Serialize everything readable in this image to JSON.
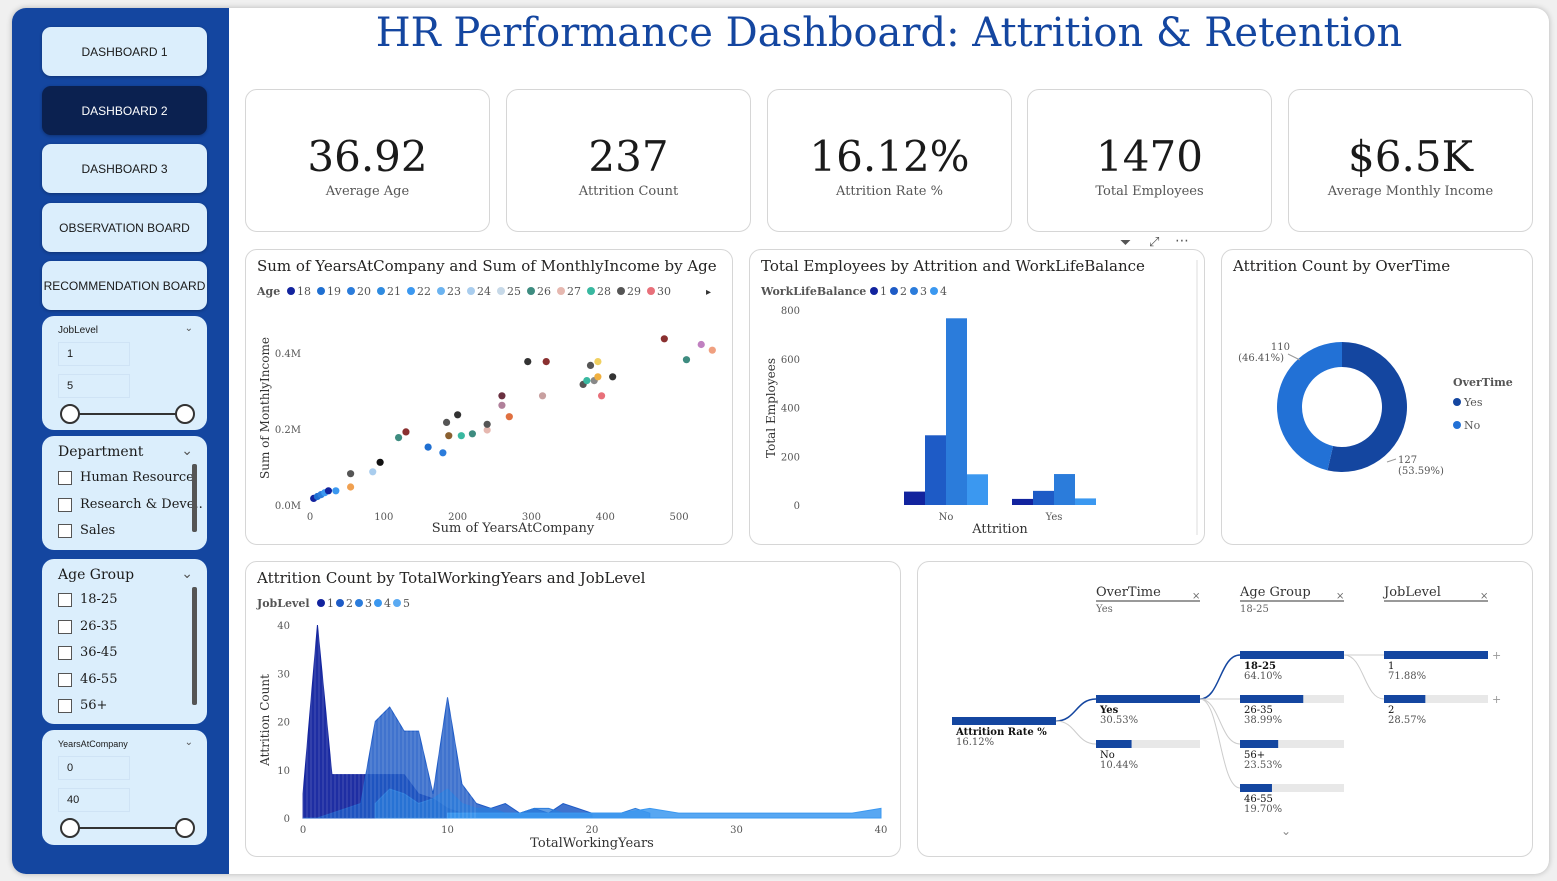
{
  "title": "HR Performance Dashboard: Attrition & Retention",
  "nav": [
    "DASHBOARD 1",
    "DASHBOARD 2",
    "DASHBOARD 3",
    "OBSERVATION BOARD",
    "RECOMMENDATION BOARD"
  ],
  "active_nav": 1,
  "slicers": {
    "joblevel": {
      "title": "JobLevel",
      "min": "1",
      "max": "5"
    },
    "department": {
      "title": "Department",
      "items": [
        "Human Resource",
        "Research & Deve..",
        "Sales"
      ]
    },
    "age_group": {
      "title": "Age Group",
      "items": [
        "18-25",
        "26-35",
        "36-45",
        "46-55",
        "56+"
      ]
    },
    "years": {
      "title": "YearsAtCompany",
      "min": "0",
      "max": "40"
    }
  },
  "kpis": [
    {
      "value": "36.92",
      "label": "Average Age"
    },
    {
      "value": "237",
      "label": "Attrition Count"
    },
    {
      "value": "16.12%",
      "label": "Attrition Rate %"
    },
    {
      "value": "1470",
      "label": "Total Employees"
    },
    {
      "value": "$6.5K",
      "label": "Average Monthly Income"
    }
  ],
  "colors": {
    "primary": "#1446a0",
    "navy": "#0b2150",
    "light": "#dbeefc",
    "blue1": "#12239e",
    "blue2": "#1e5bc6",
    "blue3": "#2b7cdb",
    "blue4": "#3b98f0"
  },
  "chart_data": [
    {
      "type": "scatter",
      "title": "Sum of YearsAtCompany and Sum of MonthlyIncome by Age",
      "xlabel": "Sum of YearsAtCompany",
      "ylabel": "Sum of MonthlyIncome",
      "legend_title": "Age",
      "legend": [
        "18",
        "19",
        "20",
        "21",
        "22",
        "23",
        "24",
        "25",
        "26",
        "27",
        "28",
        "29",
        "30"
      ],
      "legend_colors": [
        "#12239e",
        "#1f6fd1",
        "#2b7cdb",
        "#2f8be0",
        "#3b98f0",
        "#6bb3f0",
        "#a9cdee",
        "#c7d9e8",
        "#3e8c80",
        "#e6b8b0",
        "#39b8a0",
        "#555555",
        "#e8707a"
      ],
      "xticks": [
        "0",
        "100",
        "200",
        "300",
        "400",
        "500"
      ],
      "yticks": [
        "0.0M",
        "0.2M",
        "0.4M"
      ],
      "xlim": [
        0,
        550
      ],
      "ylim": [
        0,
        0.45
      ],
      "points": [
        [
          5,
          0.02,
          "#12239e"
        ],
        [
          10,
          0.025,
          "#1f6fd1"
        ],
        [
          15,
          0.03,
          "#2b7cdb"
        ],
        [
          20,
          0.035,
          "#3b98f0"
        ],
        [
          25,
          0.04,
          "#12239e"
        ],
        [
          35,
          0.04,
          "#3b98f0"
        ],
        [
          55,
          0.05,
          "#f0a050"
        ],
        [
          55,
          0.085,
          "#555555"
        ],
        [
          85,
          0.09,
          "#a9cdee"
        ],
        [
          95,
          0.115,
          "#111111"
        ],
        [
          120,
          0.18,
          "#3e8c80"
        ],
        [
          130,
          0.195,
          "#8a3030"
        ],
        [
          160,
          0.155,
          "#1f6fd1"
        ],
        [
          180,
          0.14,
          "#2b7cdb"
        ],
        [
          185,
          0.22,
          "#555555"
        ],
        [
          188,
          0.185,
          "#8a6030"
        ],
        [
          200,
          0.24,
          "#333333"
        ],
        [
          205,
          0.185,
          "#39b8a0"
        ],
        [
          220,
          0.19,
          "#3e8c80"
        ],
        [
          240,
          0.2,
          "#e6b8b0"
        ],
        [
          240,
          0.215,
          "#555555"
        ],
        [
          260,
          0.265,
          "#b0809a"
        ],
        [
          260,
          0.29,
          "#6a3040"
        ],
        [
          270,
          0.235,
          "#e07040"
        ],
        [
          295,
          0.38,
          "#333333"
        ],
        [
          315,
          0.29,
          "#c8a0a0"
        ],
        [
          320,
          0.38,
          "#8a3030"
        ],
        [
          370,
          0.32,
          "#555555"
        ],
        [
          375,
          0.33,
          "#39b8a0"
        ],
        [
          385,
          0.33,
          "#888888"
        ],
        [
          380,
          0.37,
          "#555555"
        ],
        [
          390,
          0.38,
          "#f0d060"
        ],
        [
          390,
          0.34,
          "#f0b040"
        ],
        [
          395,
          0.29,
          "#e8707a"
        ],
        [
          410,
          0.34,
          "#333333"
        ],
        [
          480,
          0.44,
          "#8a3030"
        ],
        [
          510,
          0.385,
          "#3e8c80"
        ],
        [
          530,
          0.425,
          "#c080c0"
        ],
        [
          545,
          0.41,
          "#f0a080"
        ]
      ]
    },
    {
      "type": "bar",
      "title": "Total Employees by Attrition and WorkLifeBalance",
      "xlabel": "Attrition",
      "ylabel": "Total Employees",
      "legend_title": "WorkLifeBalance",
      "legend": [
        "1",
        "2",
        "3",
        "4"
      ],
      "categories": [
        "No",
        "Yes"
      ],
      "series": [
        {
          "name": "1",
          "values": [
            55,
            25
          ]
        },
        {
          "name": "2",
          "values": [
            286,
            58
          ]
        },
        {
          "name": "3",
          "values": [
            766,
            127
          ]
        },
        {
          "name": "4",
          "values": [
            126,
            27
          ]
        }
      ],
      "yticks": [
        "0",
        "200",
        "400",
        "600",
        "800"
      ],
      "ylim": [
        0,
        800
      ]
    },
    {
      "type": "pie",
      "title": "Attrition Count by OverTime",
      "legend_title": "OverTime",
      "legend": [
        "Yes",
        "No"
      ],
      "slices": [
        {
          "name": "Yes",
          "value": 127,
          "label": "127",
          "pct": "(53.59%)"
        },
        {
          "name": "No",
          "value": 110,
          "label": "110",
          "pct": "(46.41%)"
        }
      ]
    },
    {
      "type": "area",
      "title": "Attrition Count by TotalWorkingYears and JobLevel",
      "xlabel": "TotalWorkingYears",
      "ylabel": "Attrition Count",
      "legend_title": "JobLevel",
      "legend": [
        "1",
        "2",
        "3",
        "4",
        "5"
      ],
      "xticks": [
        "0",
        "10",
        "20",
        "30",
        "40"
      ],
      "yticks": [
        "0",
        "10",
        "20",
        "30",
        "40"
      ],
      "xlim": [
        0,
        40
      ],
      "ylim": [
        0,
        40
      ],
      "series": [
        {
          "name": "1",
          "x": [
            0,
            1,
            2,
            3,
            4,
            5,
            6,
            7,
            8,
            9,
            10,
            11
          ],
          "y": [
            5,
            40,
            9,
            9,
            9,
            9,
            9,
            9,
            5,
            4,
            2,
            1
          ]
        },
        {
          "name": "2",
          "x": [
            0,
            1,
            2,
            3,
            4,
            5,
            6,
            7,
            8,
            9,
            10,
            11,
            12,
            13,
            14,
            15,
            16,
            17,
            18,
            19,
            20
          ],
          "y": [
            0,
            0,
            1,
            2,
            3,
            20,
            23,
            18,
            18,
            5,
            25,
            7,
            3,
            2,
            3,
            1,
            2,
            1,
            3,
            2,
            1
          ]
        },
        {
          "name": "3",
          "x": [
            5,
            6,
            7,
            8,
            9,
            10,
            11,
            12,
            13,
            14,
            15,
            16,
            17,
            18,
            19,
            20,
            21,
            22,
            23,
            24
          ],
          "y": [
            3,
            6,
            5,
            3,
            4,
            6,
            3,
            2,
            2,
            1,
            1,
            2,
            2,
            1,
            1,
            1,
            1,
            1,
            2,
            1
          ]
        },
        {
          "name": "4",
          "x": [
            10,
            12,
            14,
            16,
            18,
            20,
            22,
            24,
            26,
            28,
            30,
            32,
            34,
            36,
            38,
            40
          ],
          "y": [
            1,
            1,
            1,
            1,
            1,
            1,
            1,
            2,
            1,
            1,
            1,
            1,
            1,
            1,
            1,
            2
          ]
        }
      ]
    },
    {
      "type": "diagram",
      "root": {
        "label": "Attrition Rate %",
        "value": "16.12%",
        "frac": 0.1612
      },
      "levels": [
        {
          "header": "OverTime",
          "selected": "Yes",
          "nodes": [
            {
              "label": "Yes",
              "value": "30.53%",
              "frac": 0.3053
            },
            {
              "label": "No",
              "value": "10.44%",
              "frac": 0.1044
            }
          ]
        },
        {
          "header": "Age Group",
          "selected": "18-25",
          "nodes": [
            {
              "label": "18-25",
              "value": "64.10%",
              "frac": 0.641
            },
            {
              "label": "26-35",
              "value": "38.99%",
              "frac": 0.3899
            },
            {
              "label": "56+",
              "value": "23.53%",
              "frac": 0.2353
            },
            {
              "label": "46-55",
              "value": "19.70%",
              "frac": 0.197
            }
          ]
        },
        {
          "header": "JobLevel",
          "selected": "",
          "nodes": [
            {
              "label": "1",
              "value": "71.88%",
              "frac": 0.7188
            },
            {
              "label": "2",
              "value": "28.57%",
              "frac": 0.2857
            }
          ]
        }
      ]
    }
  ]
}
